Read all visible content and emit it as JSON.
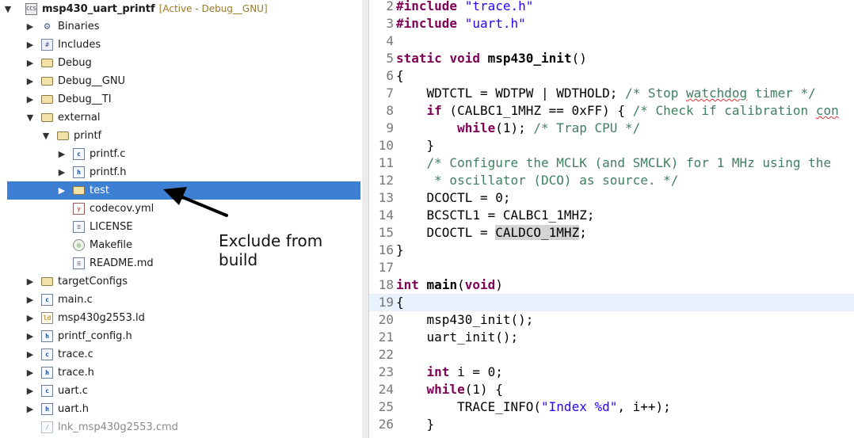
{
  "explorer": {
    "project": {
      "name": "msp430_uart_printf",
      "status": "[Active - Debug__GNU]"
    },
    "items": [
      {
        "label": "Binaries"
      },
      {
        "label": "Includes"
      },
      {
        "label": "Debug"
      },
      {
        "label": "Debug__GNU"
      },
      {
        "label": "Debug__TI"
      },
      {
        "label": "external"
      },
      {
        "label": "printf"
      },
      {
        "label": "printf.c"
      },
      {
        "label": "printf.h"
      },
      {
        "label": "test"
      },
      {
        "label": "codecov.yml"
      },
      {
        "label": "LICENSE"
      },
      {
        "label": "Makefile"
      },
      {
        "label": "README.md"
      },
      {
        "label": "targetConfigs"
      },
      {
        "label": "main.c"
      },
      {
        "label": "msp430g2553.ld"
      },
      {
        "label": "printf_config.h"
      },
      {
        "label": "trace.c"
      },
      {
        "label": "trace.h"
      },
      {
        "label": "uart.c"
      },
      {
        "label": "uart.h"
      },
      {
        "label": "lnk_msp430g2553.cmd"
      }
    ],
    "selected_item": "test"
  },
  "annotation": {
    "text": "Exclude from\nbuild"
  },
  "editor": {
    "current_line": 19,
    "lines": [
      {
        "num": "2",
        "tokens": [
          [
            "kw",
            "#include"
          ],
          [
            "p",
            " "
          ],
          [
            "str",
            "\"trace.h\""
          ]
        ]
      },
      {
        "num": "3",
        "tokens": [
          [
            "kw",
            "#include"
          ],
          [
            "p",
            " "
          ],
          [
            "str",
            "\"uart.h\""
          ]
        ]
      },
      {
        "num": "4",
        "tokens": []
      },
      {
        "num": "5",
        "tokens": [
          [
            "kw",
            "static"
          ],
          [
            "p",
            " "
          ],
          [
            "kw",
            "void"
          ],
          [
            "p",
            " "
          ],
          [
            "fn",
            "msp430_init"
          ],
          [
            "p",
            "()"
          ]
        ]
      },
      {
        "num": "6",
        "tokens": [
          [
            "p",
            "{"
          ]
        ]
      },
      {
        "num": "7",
        "tokens": [
          [
            "p",
            "    WDTCTL = WDTPW | WDTHOLD; "
          ],
          [
            "cmt",
            "/* Stop "
          ],
          [
            "cmtsq",
            "watchdog"
          ],
          [
            "cmt",
            " timer */"
          ]
        ]
      },
      {
        "num": "8",
        "tokens": [
          [
            "p",
            "    "
          ],
          [
            "kw",
            "if"
          ],
          [
            "p",
            " (CALBC1_1MHZ == 0xFF) { "
          ],
          [
            "cmt",
            "/* Check if calibration "
          ],
          [
            "cmtsq",
            "con"
          ]
        ]
      },
      {
        "num": "9",
        "tokens": [
          [
            "p",
            "        "
          ],
          [
            "kw",
            "while"
          ],
          [
            "p",
            "(1); "
          ],
          [
            "cmt",
            "/* Trap CPU */"
          ]
        ]
      },
      {
        "num": "10",
        "tokens": [
          [
            "p",
            "    }"
          ]
        ]
      },
      {
        "num": "11",
        "tokens": [
          [
            "p",
            "    "
          ],
          [
            "cmt",
            "/* Configure the MCLK (and SMCLK) for 1 MHz using the"
          ]
        ]
      },
      {
        "num": "12",
        "tokens": [
          [
            "cmt",
            "     * oscillator (DCO) as source. */"
          ]
        ]
      },
      {
        "num": "13",
        "tokens": [
          [
            "p",
            "    DCOCTL = 0;"
          ]
        ]
      },
      {
        "num": "14",
        "tokens": [
          [
            "p",
            "    BCSCTL1 = CALBC1_1MHZ;"
          ]
        ]
      },
      {
        "num": "15",
        "tokens": [
          [
            "p",
            "    DCOCTL = "
          ],
          [
            "hl",
            "CALDCO_1MHZ"
          ],
          [
            "p",
            ";"
          ]
        ]
      },
      {
        "num": "16",
        "tokens": [
          [
            "p",
            "}"
          ]
        ]
      },
      {
        "num": "17",
        "tokens": []
      },
      {
        "num": "18",
        "tokens": [
          [
            "kw",
            "int"
          ],
          [
            "p",
            " "
          ],
          [
            "fn",
            "main"
          ],
          [
            "p",
            "("
          ],
          [
            "kw",
            "void"
          ],
          [
            "p",
            ")"
          ]
        ]
      },
      {
        "num": "19",
        "tokens": [
          [
            "p",
            "{"
          ]
        ]
      },
      {
        "num": "20",
        "tokens": [
          [
            "p",
            "    msp430_init();"
          ]
        ]
      },
      {
        "num": "21",
        "tokens": [
          [
            "p",
            "    uart_init();"
          ]
        ]
      },
      {
        "num": "22",
        "tokens": []
      },
      {
        "num": "23",
        "tokens": [
          [
            "p",
            "    "
          ],
          [
            "kw",
            "int"
          ],
          [
            "p",
            " i = 0;"
          ]
        ]
      },
      {
        "num": "24",
        "tokens": [
          [
            "p",
            "    "
          ],
          [
            "kw",
            "while"
          ],
          [
            "p",
            "(1) {"
          ]
        ]
      },
      {
        "num": "25",
        "tokens": [
          [
            "p",
            "        TRACE_INFO("
          ],
          [
            "str",
            "\"Index %d\""
          ],
          [
            "p",
            ", i++);"
          ]
        ]
      },
      {
        "num": "26",
        "tokens": [
          [
            "p",
            "    }"
          ]
        ]
      }
    ]
  },
  "colors": {
    "selection": "#3d7fd3",
    "keyword": "#7f0055",
    "string": "#2a00ff",
    "comment": "#3f7f5f",
    "current_line": "#e8f2fe"
  }
}
